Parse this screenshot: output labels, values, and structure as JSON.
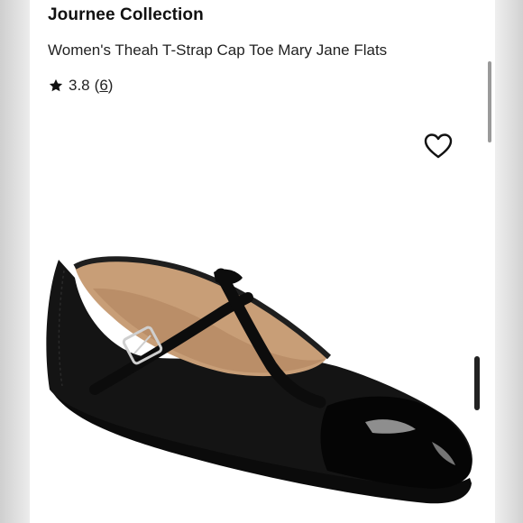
{
  "product": {
    "brand": "Journee Collection",
    "title": "Women's Theah T-Strap Cap Toe Mary Jane Flats",
    "rating_value": "3.8",
    "rating_count_open": "(",
    "rating_count": "6",
    "rating_count_close": ")"
  },
  "icons": {
    "rating": "star-icon",
    "favorite": "heart-outline-icon"
  },
  "colors": {
    "text": "#111111",
    "shoe": "#121212",
    "lining": "#c9a07a"
  }
}
